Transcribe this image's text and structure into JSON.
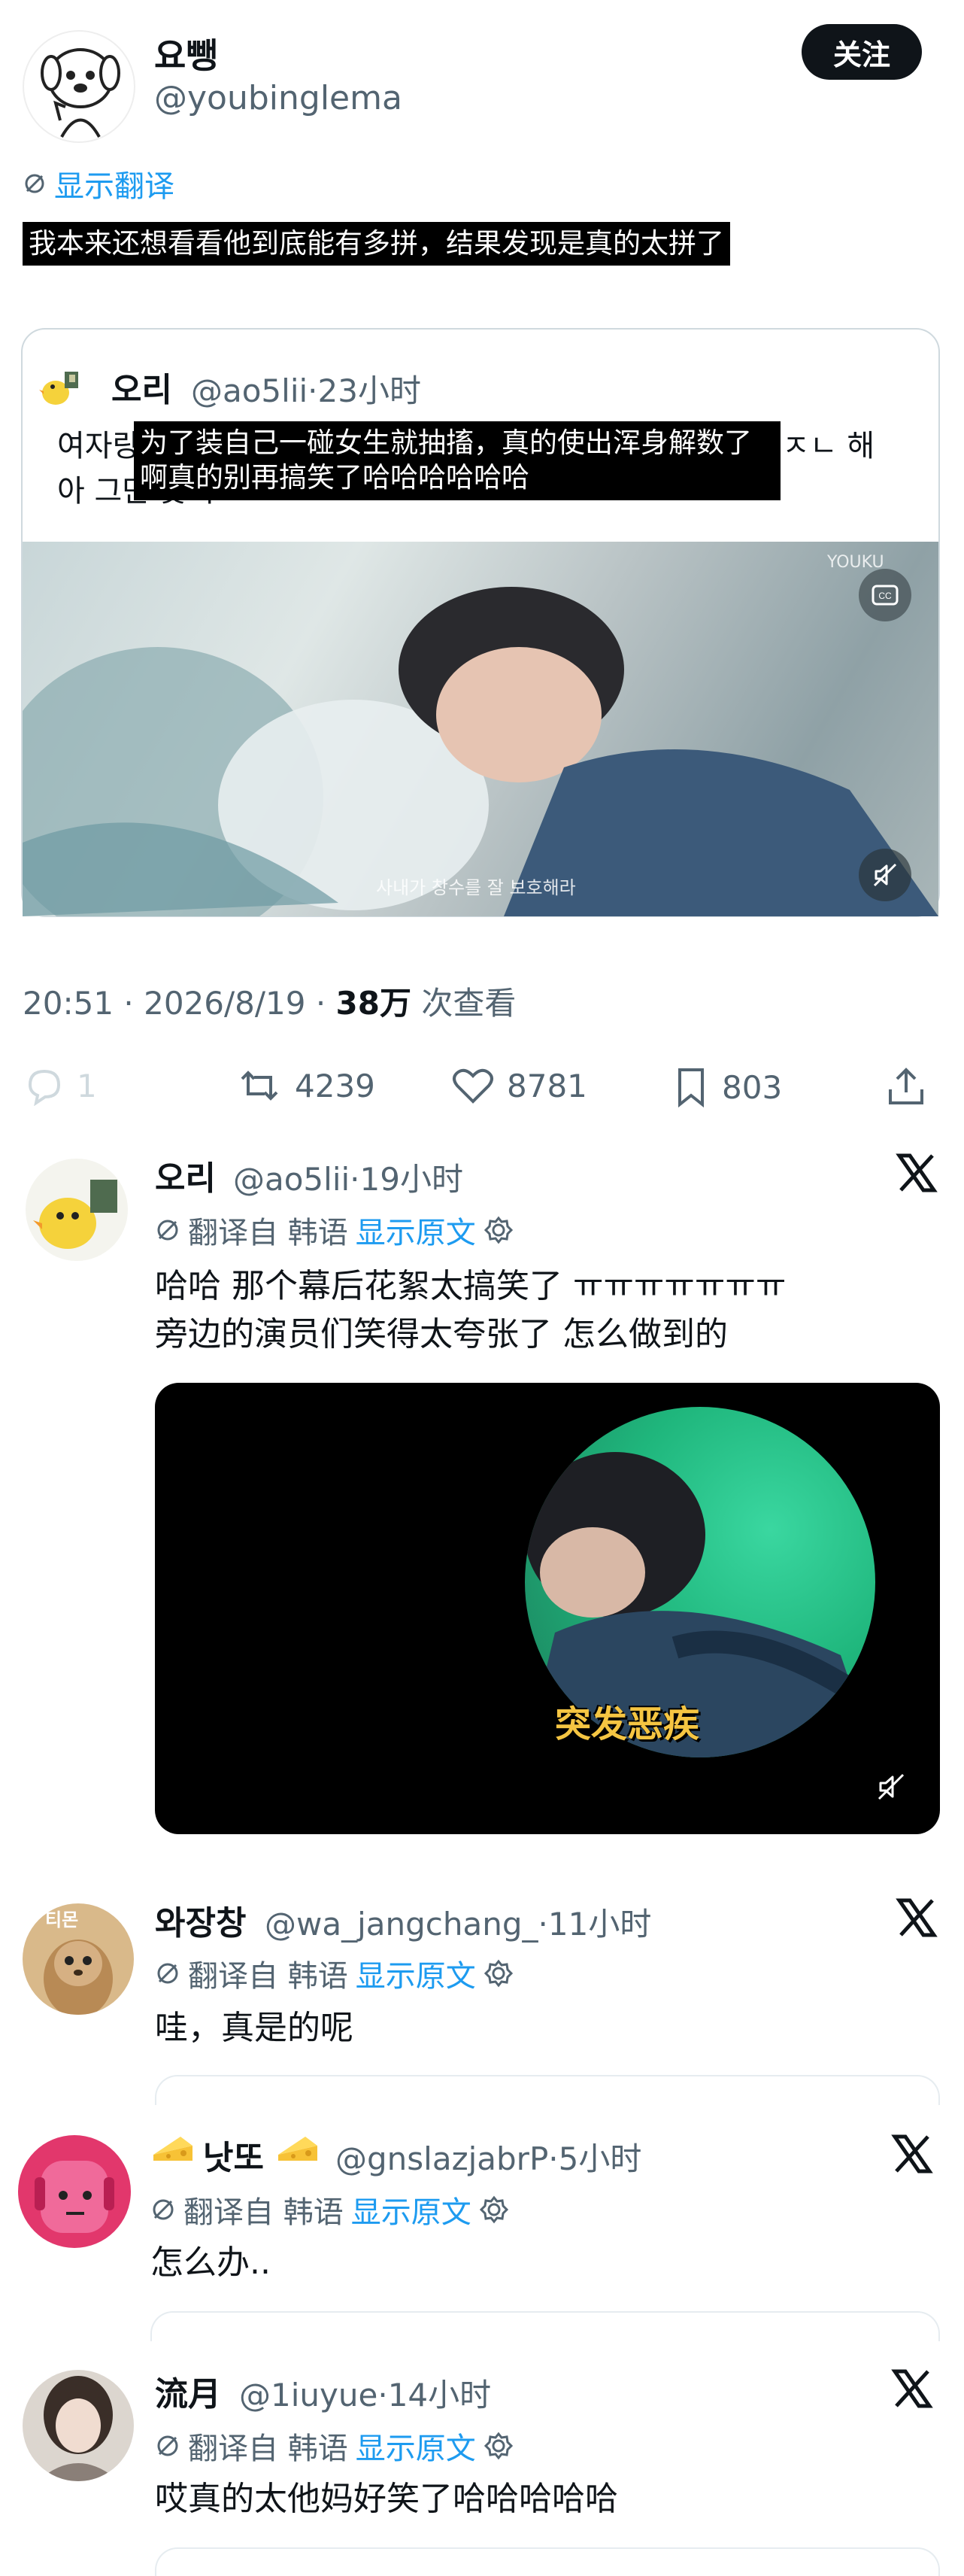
{
  "header": {
    "name": "요뺑",
    "handle": "@youbinglema",
    "follow_label": "关注",
    "show_translation": "显示翻译",
    "caption": "我本来还想看看他到底能有多拼，结果发现是真的太拼了"
  },
  "quote": {
    "name": "오리",
    "handle": "@ao5lii",
    "time": "23小时",
    "original_line1": "여자랑",
    "original_line1_end": "ㅈㄴ 해",
    "original_line2": "아 그만 웃겨",
    "caption": "为了装自己一碰女生就抽搐，真的使出浑身解数了 啊真的别再搞笑了哈哈哈哈哈哈",
    "video_subtitle": "사내가 창수를 잘 보호해라",
    "watermark": "YOUKU"
  },
  "meta": {
    "time": "20:51",
    "date": "2026/8/19",
    "views_count": "38万",
    "views_label": "次查看"
  },
  "actions": {
    "replies": "1",
    "retweets": "4239",
    "likes": "8781",
    "bookmarks": "803"
  },
  "replies": [
    {
      "name": "오리",
      "handle": "@ao5lii",
      "time": "19小时",
      "translated_from": "翻译自 韩语",
      "show_original": "显示原文",
      "text_line1": "哈哈 那个幕后花絮太搞笑了 ㅠㅠㅠㅠㅠㅠㅠ",
      "text_line2": "旁边的演员们笑得太夸张了 怎么做到的",
      "video_caption": "突发恶疾"
    },
    {
      "name": "와장창",
      "handle": "@wa_jangchang_",
      "time": "11小时",
      "avatar_text": "티몬",
      "translated_from": "翻译自 韩语",
      "show_original": "显示原文",
      "text": "哇，真是的呢"
    },
    {
      "name": "낫또",
      "handle": "@gnslazjabrP",
      "time": "5小时",
      "translated_from": "翻译自 韩语",
      "show_original": "显示原文",
      "text": "怎么办.."
    },
    {
      "name": "流月",
      "handle": "@1iuyue",
      "time": "14小时",
      "translated_from": "翻译自 韩语",
      "show_original": "显示原文",
      "text": "哎真的太他妈好笑了哈哈哈哈哈"
    }
  ],
  "colors": {
    "accent": "#1d9bf0",
    "text": "#0f1419",
    "muted": "#536471"
  }
}
